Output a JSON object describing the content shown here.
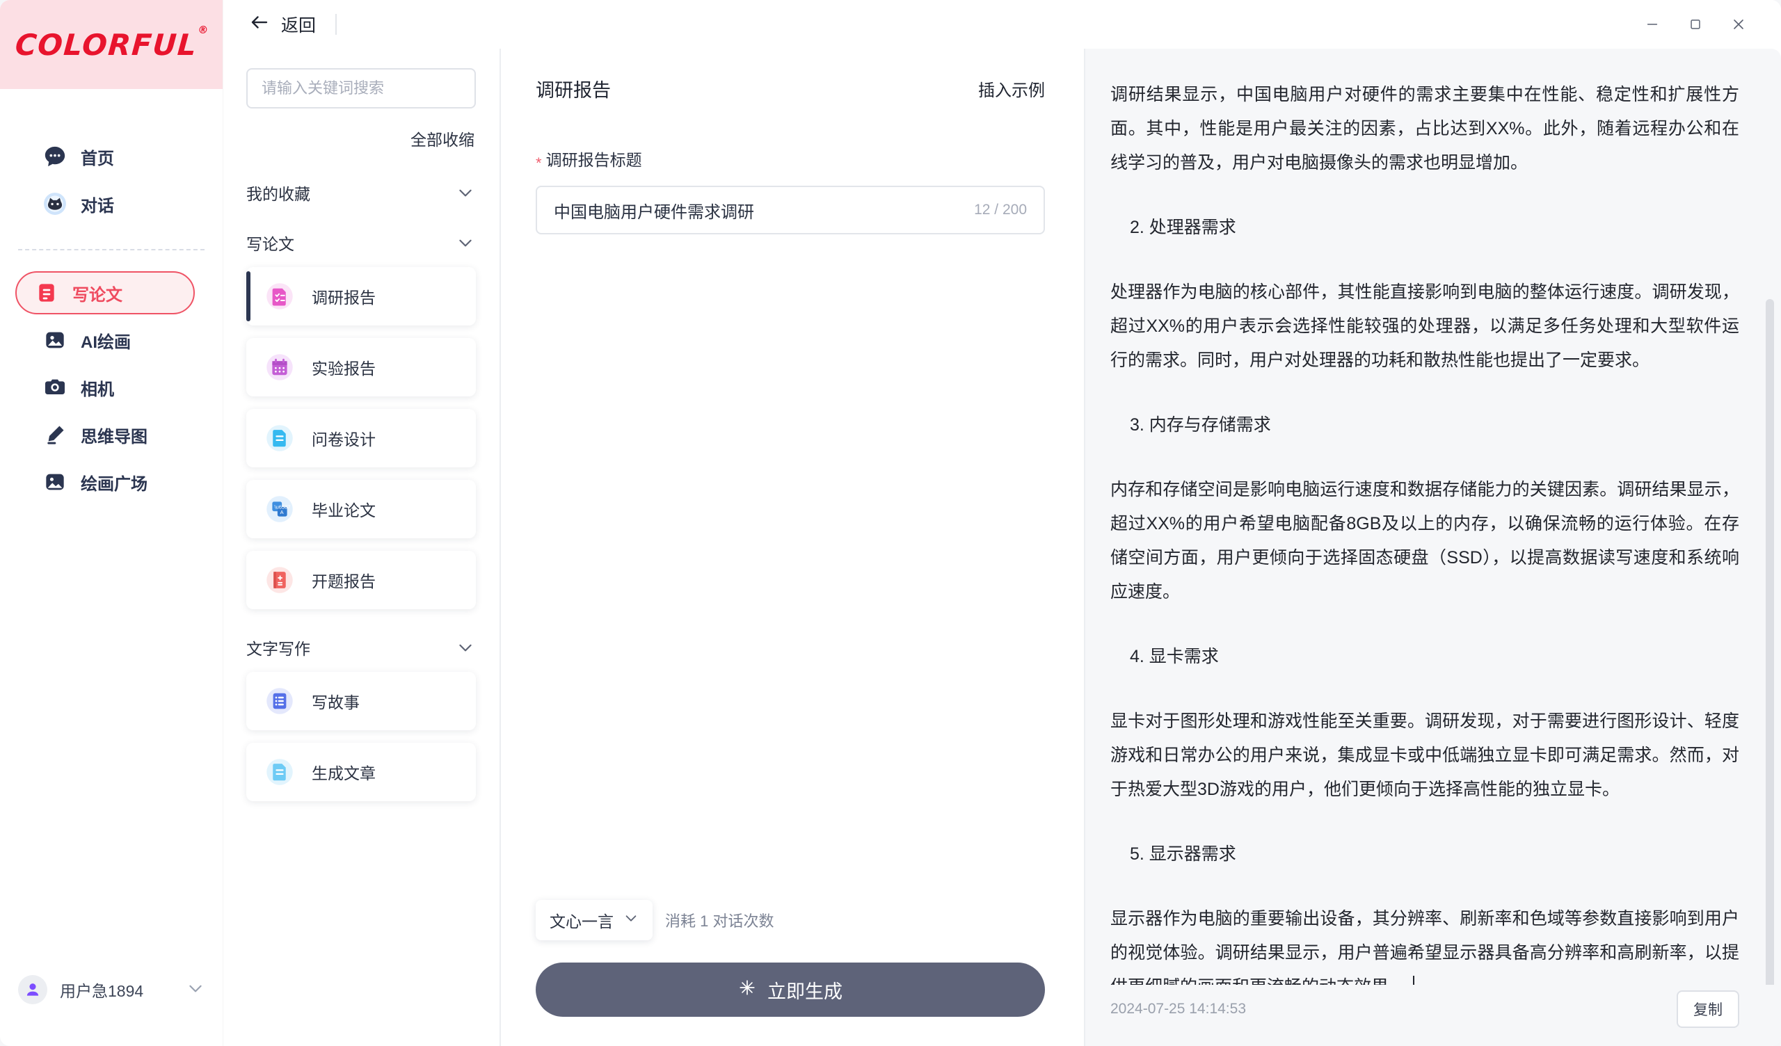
{
  "brand": {
    "name": "COLORFUL",
    "registered": "®"
  },
  "sidebar": {
    "items": [
      {
        "label": "首页",
        "icon": "chat-bubble-icon"
      },
      {
        "label": "对话",
        "icon": "cat-avatar-icon"
      },
      {
        "label": "写论文",
        "icon": "document-icon",
        "active": true
      },
      {
        "label": "AI绘画",
        "icon": "image-icon"
      },
      {
        "label": "相机",
        "icon": "camera-icon"
      },
      {
        "label": "思维导图",
        "icon": "pencil-icon"
      },
      {
        "label": "绘画广场",
        "icon": "gallery-icon"
      }
    ],
    "user": {
      "name": "用户急1894",
      "avatar_icon": "person-icon",
      "chevron_icon": "chevron-down-icon"
    }
  },
  "topbar": {
    "back_label": "返回",
    "back_icon": "arrow-left-icon",
    "minimize_icon": "minimize-icon",
    "maximize_icon": "maximize-icon",
    "close_icon": "close-icon"
  },
  "templates": {
    "search_placeholder": "请输入关键词搜索",
    "search_value": "",
    "collapse_all_label": "全部收缩",
    "groups": [
      {
        "label": "我的收藏",
        "chevron_icon": "chevron-down-icon",
        "items": []
      },
      {
        "label": "写论文",
        "chevron_icon": "chevron-down-icon",
        "items": [
          {
            "label": "调研报告",
            "icon": "checklist-doc-icon",
            "color": "#e757c7",
            "selected": true
          },
          {
            "label": "实验报告",
            "icon": "calendar-icon",
            "color": "#c45ed6",
            "selected": false
          },
          {
            "label": "问卷设计",
            "icon": "document-icon",
            "color": "#35b9f0",
            "selected": false
          },
          {
            "label": "毕业论文",
            "icon": "translate-icon",
            "color": "#3f8fe0",
            "selected": false
          },
          {
            "label": "开题报告",
            "icon": "book-icon",
            "color": "#f0635f",
            "selected": false
          }
        ]
      },
      {
        "label": "文字写作",
        "chevron_icon": "chevron-down-icon",
        "items": [
          {
            "label": "写故事",
            "icon": "list-icon",
            "color": "#5570e8",
            "selected": false
          },
          {
            "label": "生成文章",
            "icon": "document-icon",
            "color": "#35b9f0",
            "selected": false
          }
        ]
      }
    ]
  },
  "form": {
    "title": "调研报告",
    "insert_sample_label": "插入示例",
    "field_label": "调研报告标题",
    "required_mark": "*",
    "title_value": "中国电脑用户硬件需求调研",
    "title_placeholder": "",
    "counter": "12 / 200",
    "model_name": "文心一言",
    "model_chevron_icon": "chevron-down-icon",
    "consume_text": "消耗 1 对话次数",
    "generate_label": "立即生成",
    "generate_icon": "sparkle-icon"
  },
  "output": {
    "blocks": [
      {
        "type": "p",
        "text": "调研结果显示，中国电脑用户对硬件的需求主要集中在性能、稳定性和扩展性方面。其中，性能是用户最关注的因素，占比达到XX%。此外，随着远程办公和在线学习的普及，用户对电脑摄像头的需求也明显增加。"
      },
      {
        "type": "h",
        "text": "2. 处理器需求"
      },
      {
        "type": "p",
        "text": "处理器作为电脑的核心部件，其性能直接影响到电脑的整体运行速度。调研发现，超过XX%的用户表示会选择性能较强的处理器，以满足多任务处理和大型软件运行的需求。同时，用户对处理器的功耗和散热性能也提出了一定要求。"
      },
      {
        "type": "h",
        "text": "3. 内存与存储需求"
      },
      {
        "type": "p",
        "text": "内存和存储空间是影响电脑运行速度和数据存储能力的关键因素。调研结果显示，超过XX%的用户希望电脑配备8GB及以上的内存，以确保流畅的运行体验。在存储空间方面，用户更倾向于选择固态硬盘（SSD），以提高数据读写速度和系统响应速度。"
      },
      {
        "type": "h",
        "text": "4. 显卡需求"
      },
      {
        "type": "p",
        "text": "显卡对于图形处理和游戏性能至关重要。调研发现，对于需要进行图形设计、轻度游戏和日常办公的用户来说，集成显卡或中低端独立显卡即可满足需求。然而，对于热爱大型3D游戏的用户，他们更倾向于选择高性能的独立显卡。"
      },
      {
        "type": "h",
        "text": "5. 显示器需求"
      },
      {
        "type": "p",
        "text": "显示器作为电脑的重要输出设备，其分辨率、刷新率和色域等参数直接影响到用户的视觉体验。调研结果显示，用户普遍希望显示器具备高分辨率和高刷新率，以提供更细腻的画面和更流畅的动态效果。",
        "caret": true
      }
    ],
    "timestamp": "2024-07-25 14:14:53",
    "copy_label": "复制"
  },
  "colors": {
    "brand_red": "#e8142d",
    "brand_pink_bg": "#fcdfe4",
    "accent_red": "#ef4b5f",
    "sidebar_text": "#2b3550",
    "generate_btn": "#5e6379"
  }
}
